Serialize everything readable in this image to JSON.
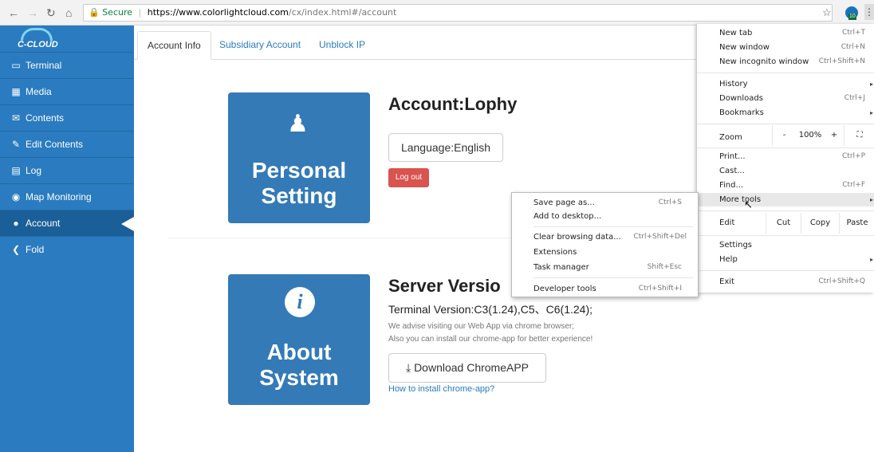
{
  "browser": {
    "secure_label": "Secure",
    "url_host": "https://www.colorlightcloud.com",
    "url_path": "/cx/index.html#/account",
    "ext_badge": "10"
  },
  "sidebar": {
    "logo_text": "C-CLOUD",
    "items": [
      {
        "label": "Terminal"
      },
      {
        "label": "Media"
      },
      {
        "label": "Contents"
      },
      {
        "label": "Edit Contents"
      },
      {
        "label": "Log"
      },
      {
        "label": "Map Monitoring"
      },
      {
        "label": "Account"
      },
      {
        "label": "Fold"
      }
    ]
  },
  "tabs": [
    {
      "label": "Account Info"
    },
    {
      "label": "Subsidiary Account"
    },
    {
      "label": "Unblock IP"
    }
  ],
  "personal": {
    "tile_line1": "Personal",
    "tile_line2": "Setting",
    "heading": "Account:Lophy",
    "language_button": "Language:English",
    "logout_button": "Log out"
  },
  "about": {
    "tile_line1": "About",
    "tile_line2": "System",
    "heading": "Server Versio",
    "terminal_version": "Terminal Version:C3(1.24),C5、C6(1.24);",
    "advise_line1": "We advise visiting our Web App via chrome browser;",
    "advise_line2": "Also you can install our chrome-app for better experience!",
    "download_button": "Download ChromeAPP",
    "howto_link": "How to install chrome-app?"
  },
  "chrome_menu": {
    "new_tab": {
      "label": "New tab",
      "shortcut": "Ctrl+T"
    },
    "new_window": {
      "label": "New window",
      "shortcut": "Ctrl+N"
    },
    "incognito": {
      "label": "New incognito window",
      "shortcut": "Ctrl+Shift+N"
    },
    "history": {
      "label": "History"
    },
    "downloads": {
      "label": "Downloads",
      "shortcut": "Ctrl+J"
    },
    "bookmarks": {
      "label": "Bookmarks"
    },
    "zoom": {
      "label": "Zoom",
      "minus": "-",
      "value": "100%",
      "plus": "+"
    },
    "print": {
      "label": "Print...",
      "shortcut": "Ctrl+P"
    },
    "cast": {
      "label": "Cast..."
    },
    "find": {
      "label": "Find...",
      "shortcut": "Ctrl+F"
    },
    "more_tools": {
      "label": "More tools"
    },
    "edit": {
      "label": "Edit",
      "cut": "Cut",
      "copy": "Copy",
      "paste": "Paste"
    },
    "settings": {
      "label": "Settings"
    },
    "help": {
      "label": "Help"
    },
    "exit": {
      "label": "Exit",
      "shortcut": "Ctrl+Shift+Q"
    }
  },
  "more_tools_menu": {
    "save_page": {
      "label": "Save page as...",
      "shortcut": "Ctrl+S"
    },
    "add_desktop": {
      "label": "Add to desktop..."
    },
    "clear_data": {
      "label": "Clear browsing data...",
      "shortcut": "Ctrl+Shift+Del"
    },
    "extensions": {
      "label": "Extensions"
    },
    "task_manager": {
      "label": "Task manager",
      "shortcut": "Shift+Esc"
    },
    "devtools": {
      "label": "Developer tools",
      "shortcut": "Ctrl+Shift+I"
    }
  }
}
